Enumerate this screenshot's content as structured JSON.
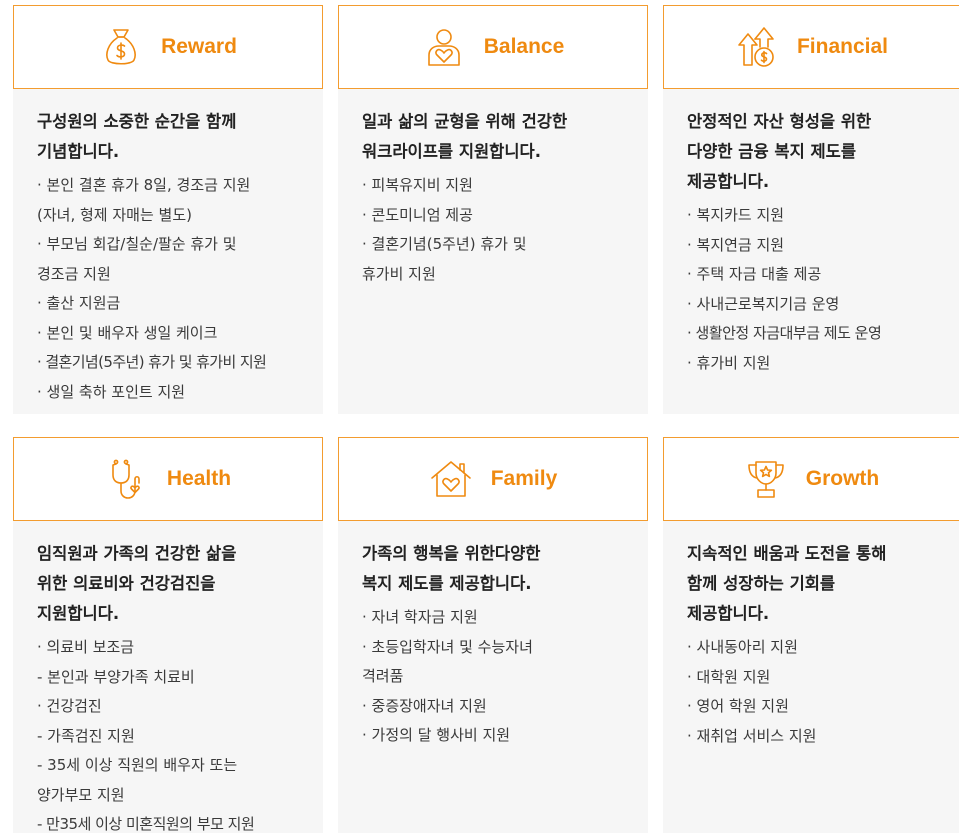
{
  "accent_color": "#ef8a10",
  "cards": [
    {
      "title": "Reward",
      "icon": "money-bag-icon",
      "headline": [
        "구성원의 소중한 순간을 함께",
        "기념합니다."
      ],
      "items": [
        "· 본인 결혼 휴가 8일, 경조금 지원",
        " (자녀, 형제 자매는 별도)",
        "· 부모님 회갑/칠순/팔순 휴가 및",
        " 경조금 지원",
        "· 출산 지원금",
        "· 본인 및 배우자 생일 케이크",
        "· 결혼기념(5주년) 휴가 및 휴가비 지원",
        "· 생일 축하 포인트 지원"
      ]
    },
    {
      "title": "Balance",
      "icon": "person-heart-icon",
      "headline": [
        "일과 삶의 균형을 위해 건강한",
        "워크라이프를 지원합니다."
      ],
      "items": [
        "· 피복유지비 지원",
        "· 콘도미니엄 제공",
        "· 결혼기념(5주년) 휴가 및",
        " 휴가비 지원"
      ]
    },
    {
      "title": "Financial",
      "icon": "growth-arrows-coin-icon",
      "headline": [
        "안정적인 자산 형성을 위한",
        "다양한 금융 복지 제도를",
        "제공합니다."
      ],
      "items": [
        "· 복지카드 지원",
        "· 복지연금 지원",
        "· 주택 자금 대출 제공",
        "· 사내근로복지기금 운영",
        "· 생활안정 자금대부금 제도 운영",
        "· 휴가비 지원"
      ]
    },
    {
      "title": "Health",
      "icon": "stethoscope-icon",
      "headline": [
        "임직원과 가족의 건강한 삶을",
        "위한 의료비와 건강검진을",
        "지원합니다."
      ],
      "items": [
        "· 의료비 보조금",
        "  - 본인과 부양가족 치료비",
        "· 건강검진",
        "- 가족검진 지원",
        "- 35세 이상 직원의 배우자 또는",
        "  양가부모 지원",
        "- 만35세 이상 미혼직원의 부모 지원"
      ]
    },
    {
      "title": "Family",
      "icon": "home-heart-icon",
      "headline": [
        "가족의 행복을 위한다양한",
        "복지 제도를 제공합니다."
      ],
      "items": [
        "· 자녀 학자금 지원",
        "· 초등입학자녀 및 수능자녀",
        " 격려품",
        "· 중증장애자녀 지원",
        "· 가정의 달 행사비 지원"
      ]
    },
    {
      "title": "Growth",
      "icon": "trophy-icon",
      "headline": [
        "지속적인 배움과 도전을 통해",
        "함께 성장하는 기회를",
        "제공합니다."
      ],
      "items": [
        "· 사내동아리 지원",
        "· 대학원 지원",
        "· 영어 학원 지원",
        "· 재취업 서비스 지원"
      ]
    }
  ]
}
